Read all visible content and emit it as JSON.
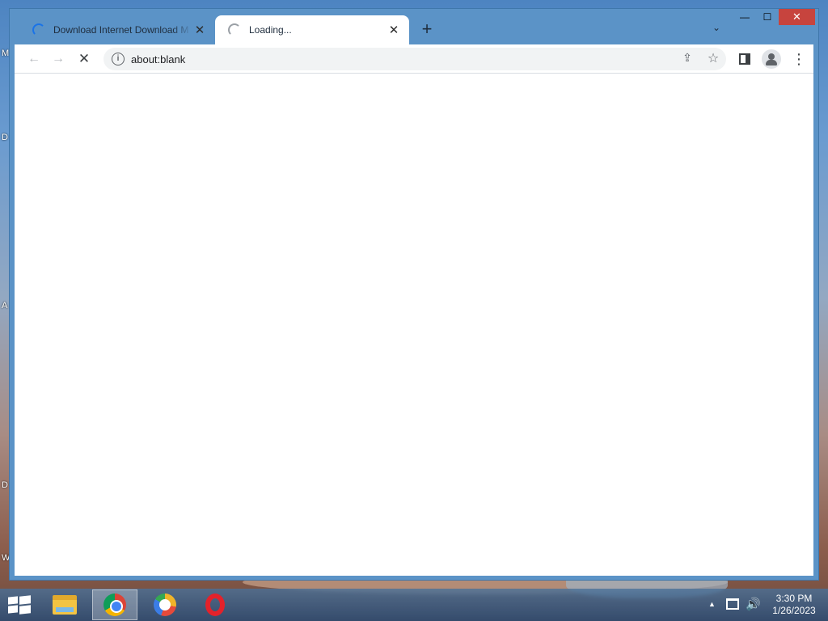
{
  "desktop": {
    "edge_letters": [
      "M",
      "D",
      "A",
      "D",
      "W"
    ]
  },
  "browser": {
    "tabs": [
      {
        "title": "Download Internet Download M",
        "state": "loading"
      },
      {
        "title": "Loading...",
        "state": "loading",
        "active": true
      }
    ],
    "address_bar": {
      "url": "about:blank"
    },
    "icons": {
      "back": "back-arrow-icon",
      "forward": "forward-arrow-icon",
      "stop": "stop-icon",
      "site_info": "info-icon",
      "share": "share-icon",
      "bookmark": "star-icon",
      "side_panel": "side-panel-icon",
      "profile": "profile-icon",
      "menu": "kebab-menu-icon"
    }
  },
  "taskbar": {
    "apps": [
      "file-explorer-icon",
      "chrome-icon",
      "secure-browser-icon",
      "opera-icon"
    ],
    "clock": {
      "time": "3:30 PM",
      "date": "1/26/2023"
    }
  },
  "colors": {
    "window_frame": "#5b93c7",
    "close_button": "#c7443e",
    "loading_spinner": "#1a73e8"
  }
}
